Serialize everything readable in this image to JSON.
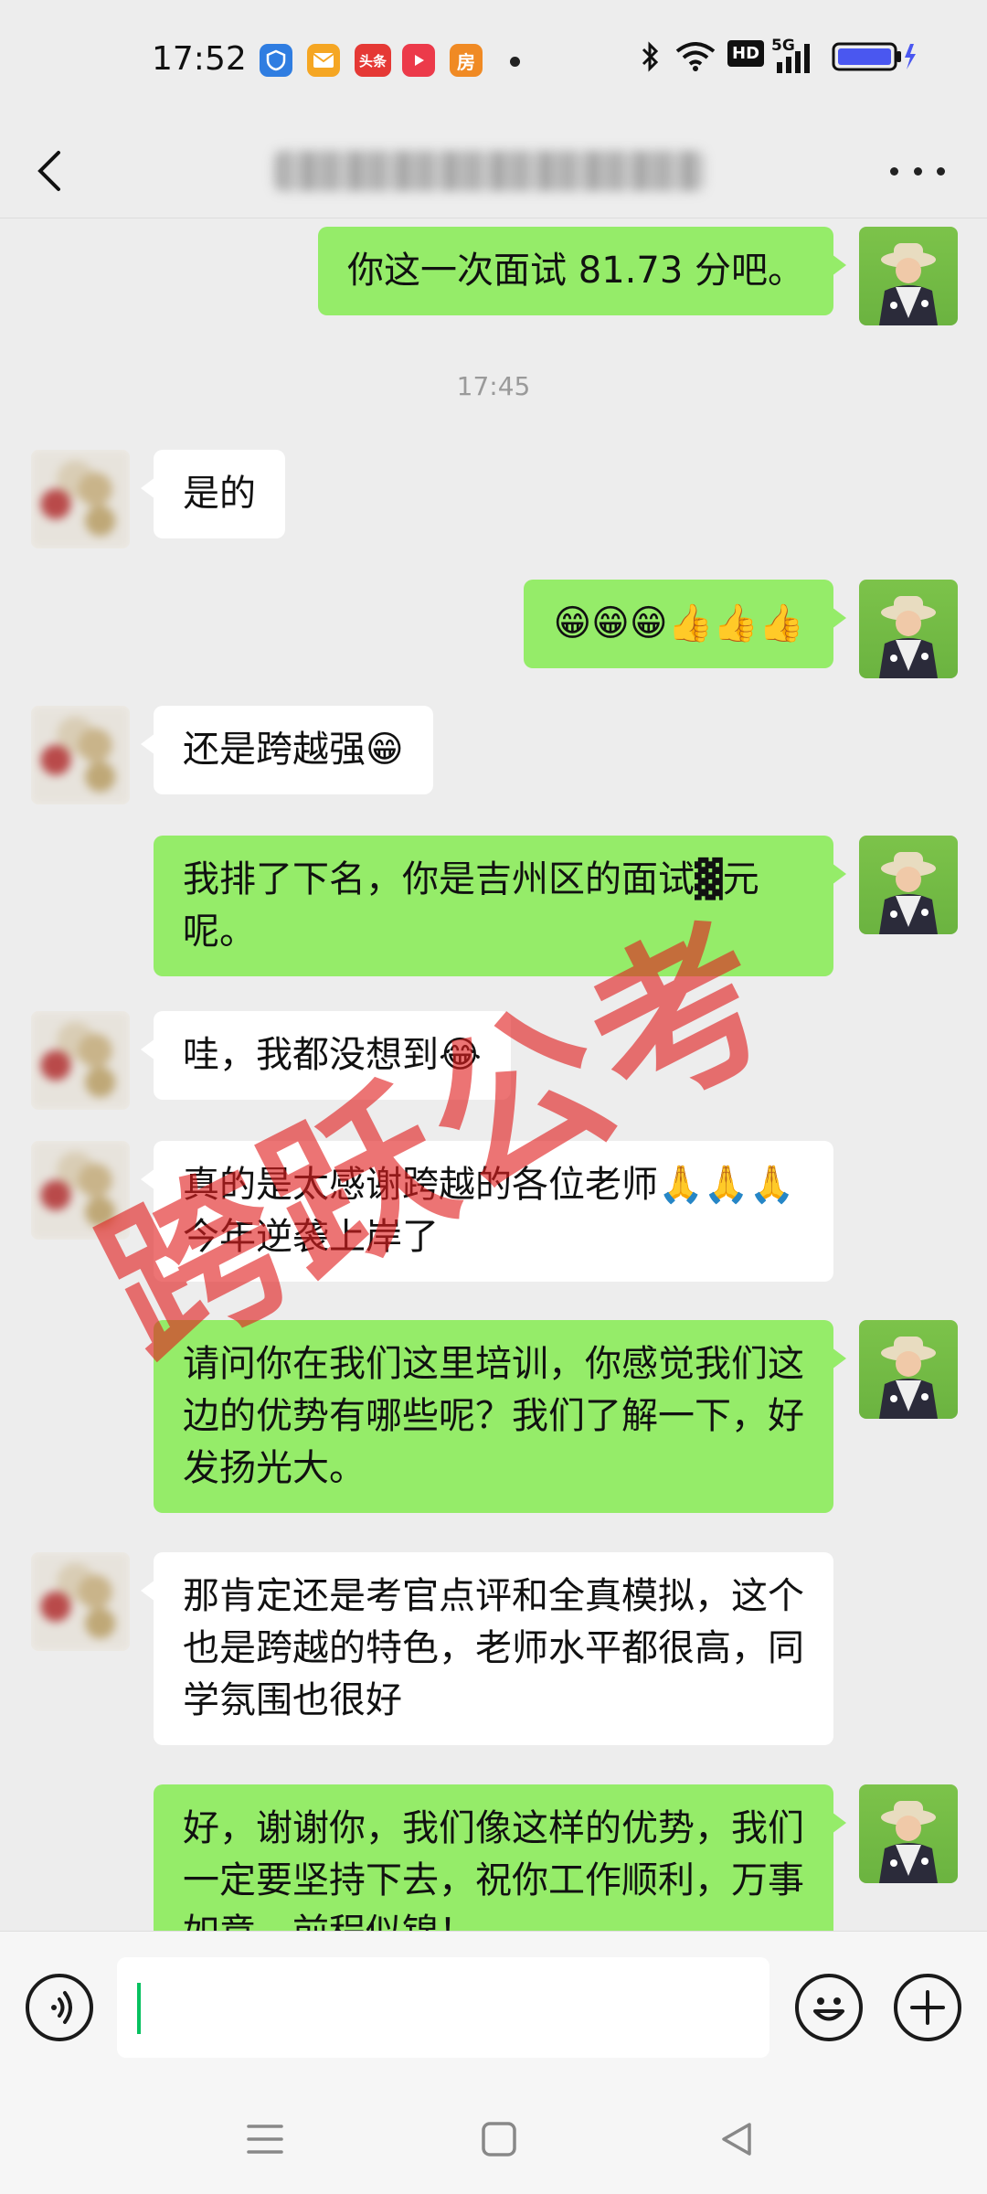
{
  "status_bar": {
    "time": "17:52",
    "app_icons": [
      {
        "name": "shield-app-icon",
        "color": "#2f7de1",
        "text": ""
      },
      {
        "name": "mail-app-icon",
        "color": "#f5a623",
        "text": ""
      },
      {
        "name": "toutiao-app-icon",
        "color": "#e53935",
        "text": "头条"
      },
      {
        "name": "video-app-icon",
        "color": "#ec3a4a",
        "text": ""
      },
      {
        "name": "house-app-icon",
        "color": "#f08a24",
        "text": "房"
      }
    ],
    "network_label": "HD",
    "signal_label": "5G"
  },
  "header": {
    "title": ""
  },
  "messages": [
    {
      "side": "self",
      "text": "你这一次面试 81.73 分吧。"
    },
    {
      "side": "time",
      "text": "17:45"
    },
    {
      "side": "other",
      "text": "是的"
    },
    {
      "side": "self",
      "text": "😁😁😁👍👍👍"
    },
    {
      "side": "other",
      "text": "还是跨越强😁"
    },
    {
      "side": "self",
      "text": "我排了下名，你是吉州区的面试▓元呢。"
    },
    {
      "side": "other",
      "text": "哇，我都没想到😂"
    },
    {
      "side": "other",
      "text": "真的是太感谢跨越的各位老师🙏🙏🙏今年逆袭上岸了"
    },
    {
      "side": "self",
      "text": "请问你在我们这里培训，你感觉我们这边的优势有哪些呢？我们了解一下，好发扬光大。"
    },
    {
      "side": "other",
      "text": "那肯定还是考官点评和全真模拟，这个也是跨越的特色，老师水平都很高，同学氛围也很好"
    },
    {
      "side": "self",
      "text": "好，谢谢你，我们像这样的优势，我们一定要坚持下去，祝你工作顺利，万事如意，前程似锦！"
    }
  ],
  "watermark": "跨跃公考",
  "input": {
    "value": "",
    "placeholder": ""
  },
  "colors": {
    "self_bubble": "#95ec69",
    "other_bubble": "#ffffff",
    "background": "#ededed",
    "cursor": "#07c160"
  }
}
